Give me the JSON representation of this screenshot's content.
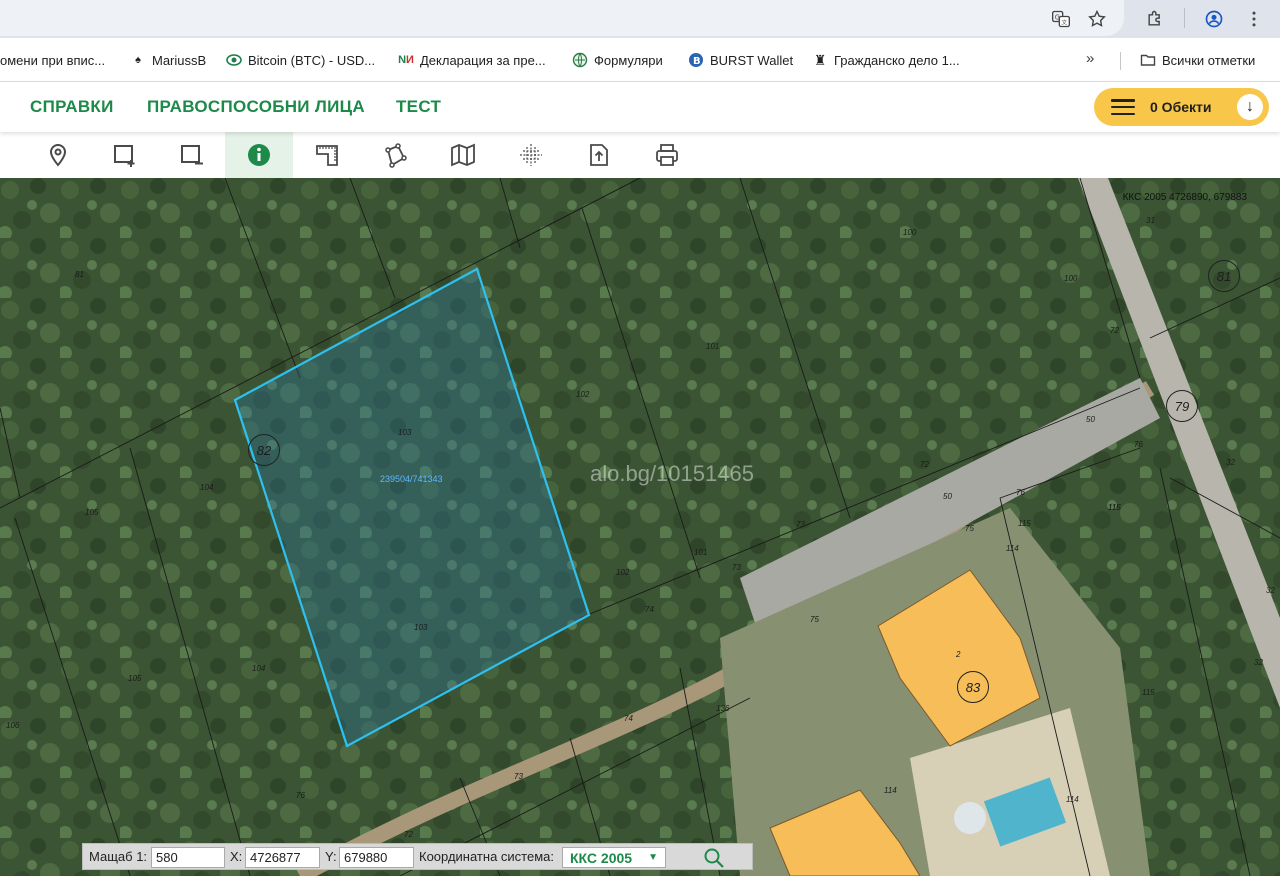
{
  "browser": {
    "icons": [
      "translate-icon",
      "star-icon",
      "extensions-icon",
      "profile-icon",
      "kebab-menu-icon"
    ]
  },
  "bookmarks": {
    "items": [
      {
        "label": "омени при впис...",
        "icon": ""
      },
      {
        "label": "MariussB",
        "icon": "spade-icon"
      },
      {
        "label": "Bitcoin (BTC) - USD...",
        "icon": "coin-icon"
      },
      {
        "label": "Декларация за пре...",
        "icon": "ni-icon"
      },
      {
        "label": "Формуляри",
        "icon": "globe-icon"
      },
      {
        "label": "BURST Wallet",
        "icon": "burst-icon"
      },
      {
        "label": "Гражданско дело 1...",
        "icon": "lion-icon"
      }
    ],
    "more": "»",
    "all_bookmarks": "Всички отметки"
  },
  "nav": {
    "links": [
      "СПРАВКИ",
      "ПРАВОСПОСОБНИ ЛИЦА",
      "ТЕСТ"
    ],
    "objects_label": "0 Обекти",
    "objects_accent": "#f8c74a",
    "nav_color": "#1d8a4a"
  },
  "toolbar": {
    "tools": [
      "pan-arrow-icon",
      "location-pin-icon",
      "add-rectangle-icon",
      "remove-rectangle-icon",
      "info-icon",
      "measure-area-icon",
      "polygon-icon",
      "map-icon",
      "coordinates-grid-icon",
      "export-icon",
      "print-icon"
    ],
    "active_tool": "info-icon"
  },
  "map": {
    "coord_readout": "ККС 2005 4726890, 679883",
    "watermark": "alo.bg/10151465",
    "parcel_id": "239504/741343",
    "parcel_outline_color": "#2ec0f0",
    "lot_numbers": [
      "81",
      "100",
      "100",
      "72",
      "31",
      "101",
      "102",
      "103",
      "104",
      "105",
      "106",
      "105",
      "104",
      "103",
      "102",
      "101",
      "72",
      "50",
      "76",
      "73",
      "73",
      "74",
      "75",
      "76",
      "75",
      "114",
      "115",
      "115",
      "115",
      "74",
      "73",
      "72",
      "50",
      "136",
      "76",
      "2",
      "114",
      "114",
      "115",
      "32",
      "32",
      "32"
    ],
    "circle_numbers": [
      "82",
      "81",
      "79",
      "83"
    ]
  },
  "status_bar": {
    "scale_label": "Мащаб 1:",
    "scale_value": "580",
    "x_label": "X:",
    "x_value": "4726877",
    "y_label": "Y:",
    "y_value": "679880",
    "crs_label": "Координатна система:",
    "crs_value": "ККС 2005"
  }
}
